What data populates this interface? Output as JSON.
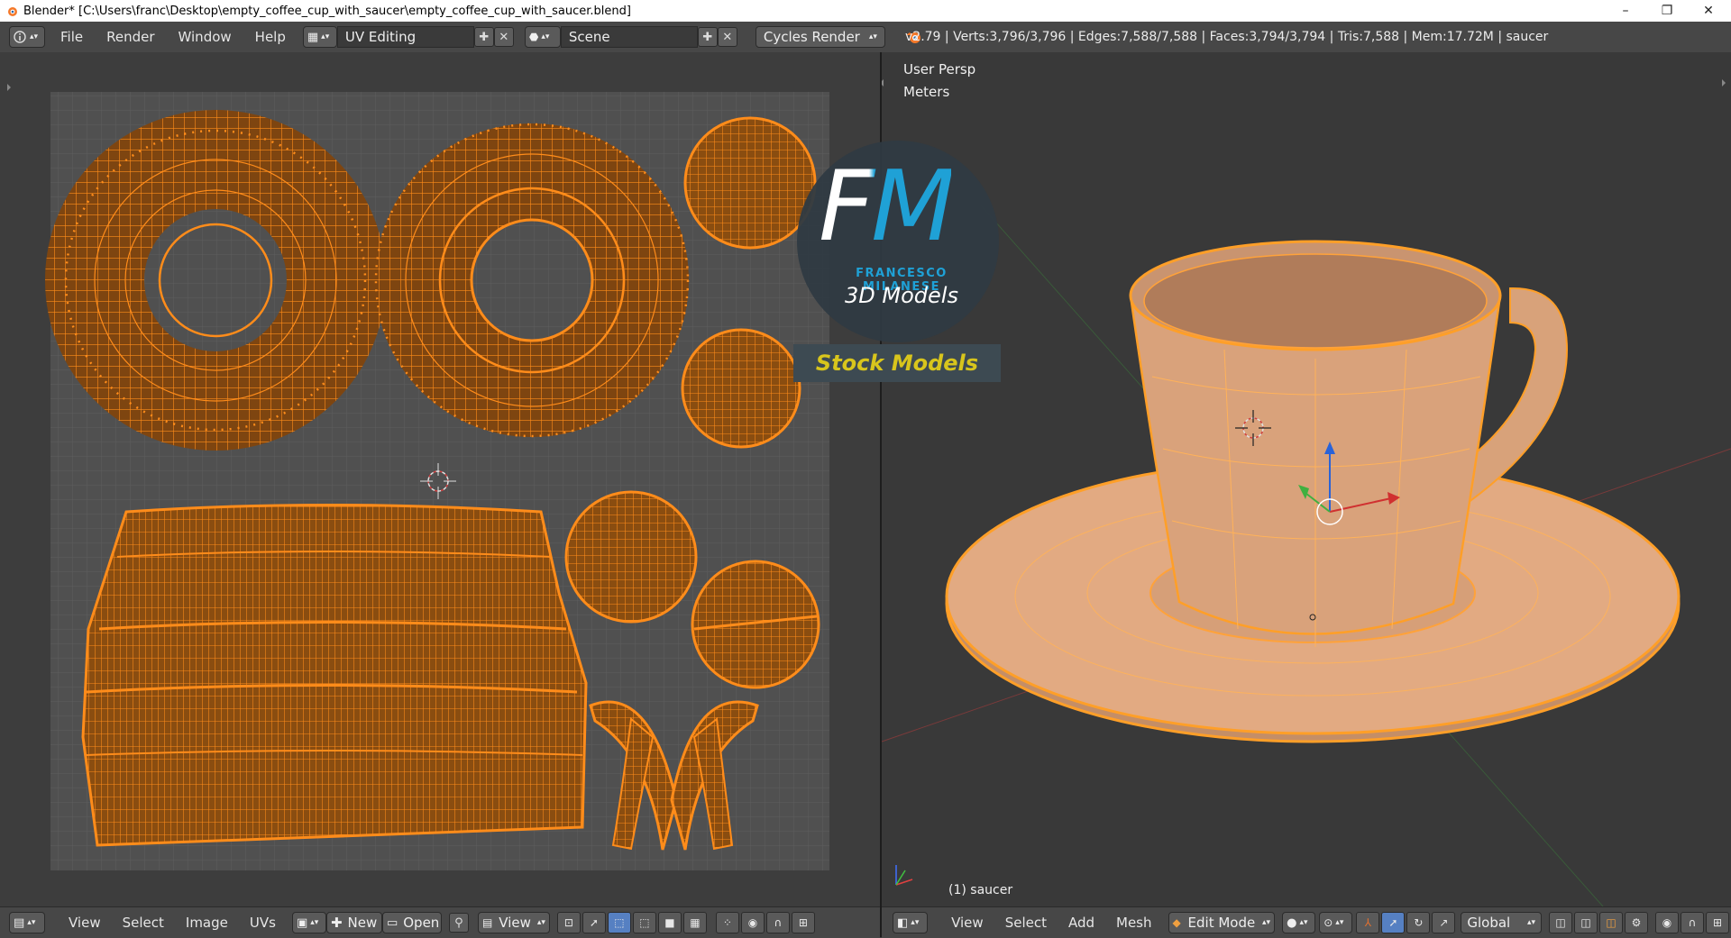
{
  "window": {
    "title": "Blender* [C:\\Users\\franc\\Desktop\\empty_coffee_cup_with_saucer\\empty_coffee_cup_with_saucer.blend]",
    "minimize": "–",
    "maximize": "❐",
    "close": "✕"
  },
  "menubar": {
    "items": [
      "File",
      "Render",
      "Window",
      "Help"
    ],
    "screen_layout": "UV Editing",
    "scene": "Scene",
    "render_engine": "Cycles Render",
    "stats": "v2.79 | Verts:3,796/3,796 | Edges:7,588/7,588 | Faces:3,794/3,794 | Tris:7,588 | Mem:17.72M | saucer"
  },
  "viewport": {
    "view_name": "User Persp",
    "units": "Meters",
    "object_label": "(1) saucer"
  },
  "watermark": {
    "logo_text": "FM",
    "brand": "FRANCESCO MILANESE",
    "subtitle": "3D Models",
    "banner": "Stock Models"
  },
  "uv_footer": {
    "items": [
      "View",
      "Select",
      "Image",
      "UVs"
    ],
    "new_label": "New",
    "open_label": "Open",
    "view_label": "View"
  },
  "viewport_footer": {
    "items": [
      "View",
      "Select",
      "Add",
      "Mesh"
    ],
    "mode": "Edit Mode",
    "orientation": "Global"
  },
  "colors": {
    "uv_edge": "#ff8c1a",
    "mesh_fill": "#e0a57c",
    "accent_blue": "#1fa1d6",
    "banner_yellow": "#d8c51c"
  }
}
